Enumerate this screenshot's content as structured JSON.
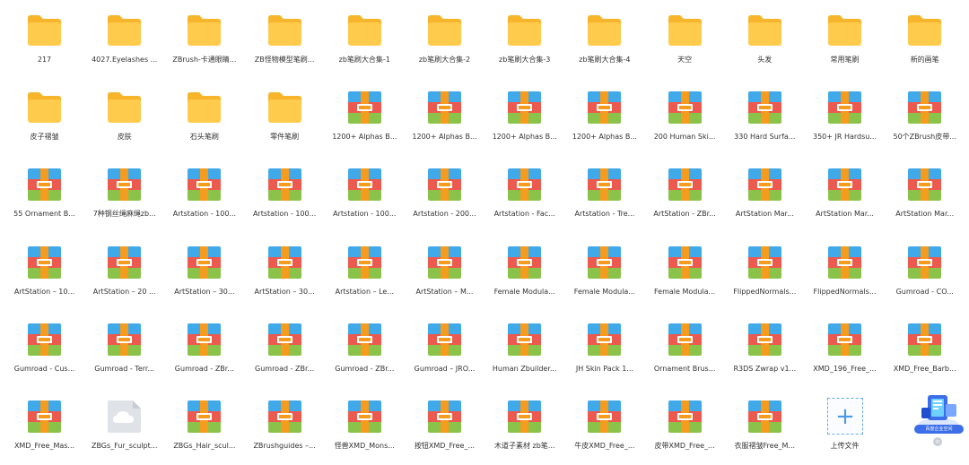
{
  "colors": {
    "folder": "#ffcb4d",
    "folder_dark": "#f7b52c",
    "archive_blue": "#3fa9ea",
    "archive_red": "#ec5a4f",
    "archive_green": "#8bc34a",
    "archive_orange": "#f59b1d",
    "cloud_tile": "#dfe3e8",
    "label_text": "#333333"
  },
  "items": [
    {
      "type": "folder",
      "label": "217"
    },
    {
      "type": "folder",
      "label": "4027.Eyelashes ..."
    },
    {
      "type": "folder",
      "label": "ZBrush-卡通眼睛..."
    },
    {
      "type": "folder",
      "label": "ZB怪物模型笔刷..."
    },
    {
      "type": "folder",
      "label": "zb笔刷大合集-1"
    },
    {
      "type": "folder",
      "label": "zb笔刷大合集-2"
    },
    {
      "type": "folder",
      "label": "zb笔刷大合集-3"
    },
    {
      "type": "folder",
      "label": "zb笔刷大合集-4"
    },
    {
      "type": "folder",
      "label": "天空"
    },
    {
      "type": "folder",
      "label": "头发"
    },
    {
      "type": "folder",
      "label": "常用笔刷"
    },
    {
      "type": "folder",
      "label": "新的画笔"
    },
    {
      "type": "folder",
      "label": "皮子褶皱"
    },
    {
      "type": "folder",
      "label": "皮肤"
    },
    {
      "type": "folder",
      "label": "石头笔刷"
    },
    {
      "type": "folder",
      "label": "零件笔刷"
    },
    {
      "type": "archive",
      "label": "1200+ Alphas B..."
    },
    {
      "type": "archive",
      "label": "1200+ Alphas B..."
    },
    {
      "type": "archive",
      "label": "1200+ Alphas B..."
    },
    {
      "type": "archive",
      "label": "1200+ Alphas B..."
    },
    {
      "type": "archive",
      "label": "200 Human Ski..."
    },
    {
      "type": "archive",
      "label": "330 Hard Surfa..."
    },
    {
      "type": "archive",
      "label": "350+ JR Hardsu..."
    },
    {
      "type": "archive",
      "label": "50个ZBrush皮带..."
    },
    {
      "type": "archive",
      "label": "55 Ornament B..."
    },
    {
      "type": "archive",
      "label": "7种钢丝绳麻绳zb..."
    },
    {
      "type": "archive",
      "label": "Artstation - 100..."
    },
    {
      "type": "archive",
      "label": "Artstation - 100..."
    },
    {
      "type": "archive",
      "label": "Artstation - 100..."
    },
    {
      "type": "archive",
      "label": "Artstation - 200..."
    },
    {
      "type": "archive",
      "label": "Artstation - Fac..."
    },
    {
      "type": "archive",
      "label": "Artstation - Tre..."
    },
    {
      "type": "archive",
      "label": "ArtStation - ZBr..."
    },
    {
      "type": "archive",
      "label": "ArtStation Mar..."
    },
    {
      "type": "archive",
      "label": "ArtStation Mar..."
    },
    {
      "type": "archive",
      "label": "ArtStation Mar..."
    },
    {
      "type": "archive",
      "label": "ArtStation – 10..."
    },
    {
      "type": "archive",
      "label": "ArtStation – 20 ..."
    },
    {
      "type": "archive",
      "label": "ArtStation – 30..."
    },
    {
      "type": "archive",
      "label": "ArtStation – 30..."
    },
    {
      "type": "archive",
      "label": "Artstation – Le..."
    },
    {
      "type": "archive",
      "label": "ArtStation – M..."
    },
    {
      "type": "archive",
      "label": "Female Modula..."
    },
    {
      "type": "archive",
      "label": "Female Modula..."
    },
    {
      "type": "archive",
      "label": "Female Modula..."
    },
    {
      "type": "archive",
      "label": "FlippedNormals..."
    },
    {
      "type": "archive",
      "label": "FlippedNormals..."
    },
    {
      "type": "archive",
      "label": "Gumroad - CO..."
    },
    {
      "type": "archive",
      "label": "Gumroad - Cus..."
    },
    {
      "type": "archive",
      "label": "Gumroad - Terr..."
    },
    {
      "type": "archive",
      "label": "Gumroad - ZBr..."
    },
    {
      "type": "archive",
      "label": "Gumroad - ZBr..."
    },
    {
      "type": "archive",
      "label": "Gumroad - ZBr..."
    },
    {
      "type": "archive",
      "label": "Gumroad – JRO..."
    },
    {
      "type": "archive",
      "label": "Human Zbuilder..."
    },
    {
      "type": "archive",
      "label": "JH Skin Pack 1..."
    },
    {
      "type": "archive",
      "label": "Ornament Brus..."
    },
    {
      "type": "archive",
      "label": "R3DS Zwrap v1..."
    },
    {
      "type": "archive",
      "label": "XMD_196_Free_..."
    },
    {
      "type": "archive",
      "label": "XMD_Free_Barb..."
    },
    {
      "type": "archive",
      "label": "XMD_Free_Mas..."
    },
    {
      "type": "cloud",
      "label": "ZBGs_Fur_sculpt..."
    },
    {
      "type": "archive",
      "label": "ZBGs_Hair_scul..."
    },
    {
      "type": "archive",
      "label": "ZBrushguides –..."
    },
    {
      "type": "archive",
      "label": "怪兽XMD_Mons..."
    },
    {
      "type": "archive",
      "label": "按钮XMD_Free_..."
    },
    {
      "type": "archive",
      "label": "木道子素材 zb笔..."
    },
    {
      "type": "archive",
      "label": "牛皮XMD_Free_..."
    },
    {
      "type": "archive",
      "label": "皮带XMD_Free_..."
    },
    {
      "type": "archive",
      "label": "衣服褶皱Free_M..."
    },
    {
      "type": "upload",
      "label": "上传文件"
    }
  ],
  "widget": {
    "label": "百度企业空间",
    "close": "×",
    "icon": "cloud-drive-icon"
  }
}
